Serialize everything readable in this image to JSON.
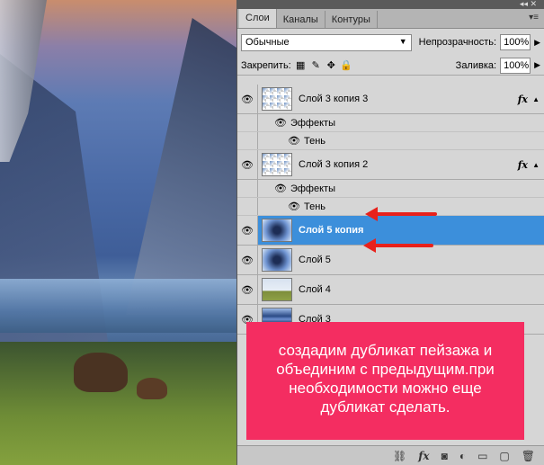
{
  "panel": {
    "tabs": [
      "Слои",
      "Каналы",
      "Контуры"
    ],
    "blend_mode": "Обычные",
    "opacity_label": "Непрозрачность:",
    "opacity_value": "100%",
    "lock_label": "Закрепить:",
    "fill_label": "Заливка:",
    "fill_value": "100%"
  },
  "layers": [
    {
      "name": "Слой 3 копия 3",
      "fx": "fx",
      "effects_label": "Эффекты",
      "effect": "Тень"
    },
    {
      "name": "Слой 3 копия 2",
      "fx": "fx",
      "effects_label": "Эффекты",
      "effect": "Тень"
    },
    {
      "name": "Слой 5 копия",
      "selected": true
    },
    {
      "name": "Слой 5"
    },
    {
      "name": "Слой 4"
    },
    {
      "name": "Слой 3"
    }
  ],
  "note": {
    "text": "создадим дубликат пейзажа и объединим с предыдущим.при необходимости можно еще дубликат сделать."
  },
  "colors": {
    "selection": "#3c8fdb",
    "note_bg": "#f42d61",
    "arrow": "#e8211b"
  }
}
